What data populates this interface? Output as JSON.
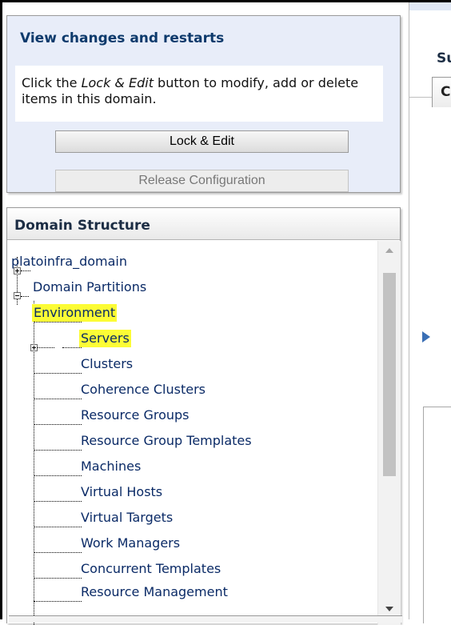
{
  "change_center": {
    "title": "View changes and restarts",
    "desc_prefix": "Click the ",
    "desc_em": "Lock & Edit",
    "desc_suffix": " button to modify, add or delete items in this domain.",
    "lock_button": "Lock & Edit",
    "release_button": "Release Configuration"
  },
  "domain_structure": {
    "title": "Domain Structure",
    "root": "platoinfra_domain",
    "items": [
      {
        "label": "Domain Partitions",
        "expander": "plus",
        "highlighted": false
      },
      {
        "label": "Environment",
        "expander": "minus",
        "highlighted": true
      },
      {
        "label": "Servers",
        "highlighted": true
      },
      {
        "label": "Clusters",
        "expander": "plus"
      },
      {
        "label": "Coherence Clusters"
      },
      {
        "label": "Resource Groups"
      },
      {
        "label": "Resource Group Templates"
      },
      {
        "label": "Machines"
      },
      {
        "label": "Virtual Hosts"
      },
      {
        "label": "Virtual Targets"
      },
      {
        "label": "Work Managers"
      },
      {
        "label": "Concurrent Templates"
      },
      {
        "label": "Resource Management"
      }
    ]
  },
  "right_panel": {
    "label": "Su",
    "tab_glyph": "C"
  },
  "colors": {
    "highlight": "#fcfc35",
    "link": "#0a2a66",
    "header_text": "#0d3a6c"
  }
}
